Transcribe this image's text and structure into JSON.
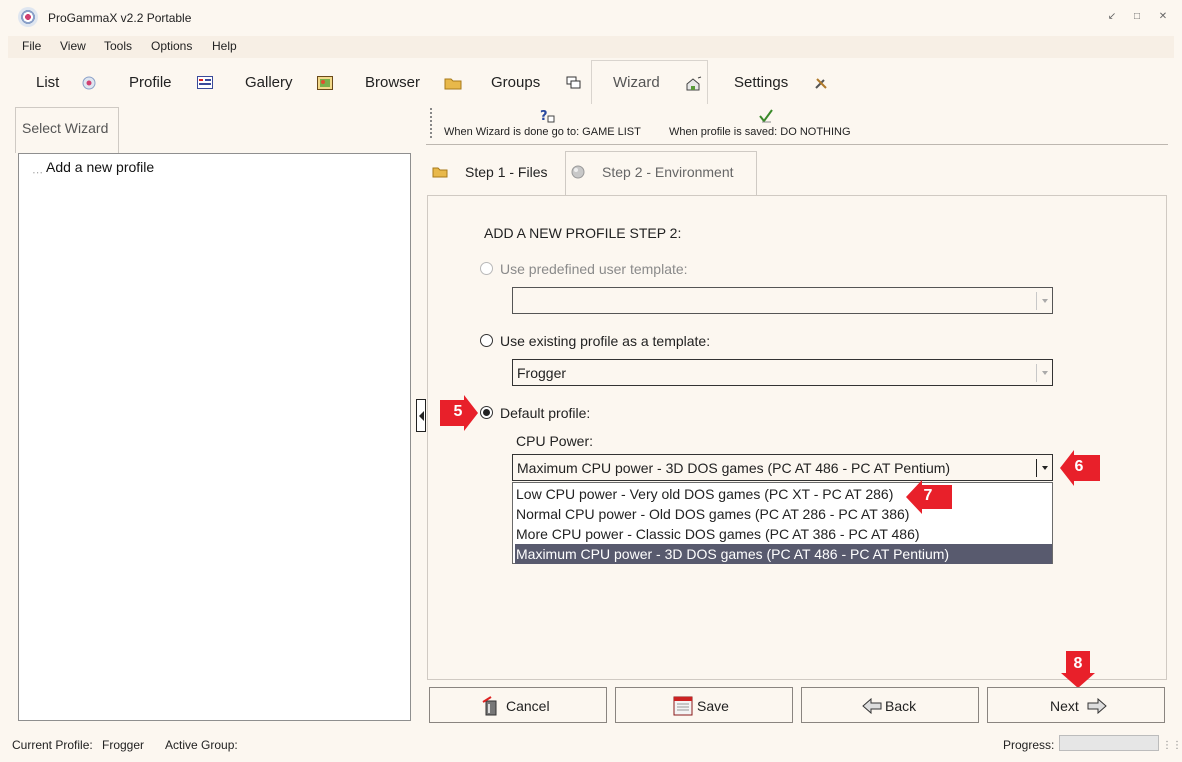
{
  "window": {
    "title": "ProGammaX v2.2 Portable"
  },
  "menu": [
    "File",
    "View",
    "Tools",
    "Options",
    "Help"
  ],
  "main_tabs": {
    "list": "List",
    "profile": "Profile",
    "gallery": "Gallery",
    "browser": "Browser",
    "groups": "Groups",
    "wizard": "Wizard",
    "settings": "Settings",
    "active": "Wizard"
  },
  "left_pane": {
    "tab_label": "Select Wizard",
    "tree_items": [
      "Add a new profile"
    ]
  },
  "toolbar": {
    "wizard_done": "When Wizard is done go to: GAME LIST",
    "profile_saved": "When profile is saved: DO NOTHING"
  },
  "step_tabs": {
    "step1": "Step 1 - Files",
    "step2": "Step 2 - Environment",
    "active": "Step 2 - Environment"
  },
  "content": {
    "heading": "ADD A NEW PROFILE STEP 2:",
    "option_predefined": "Use predefined user template:",
    "predefined_value": "",
    "option_existing": "Use existing profile as a template:",
    "existing_value": "Frogger",
    "option_default": "Default profile:",
    "selected_option": "Default profile:",
    "cpu_label": "CPU Power:",
    "cpu_value": "Maximum CPU power - 3D DOS games (PC AT 486 - PC AT Pentium)",
    "cpu_options": [
      "Low CPU power - Very old DOS games (PC XT - PC AT 286)",
      "Normal CPU power - Old DOS games (PC AT 286 - PC AT 386)",
      "More CPU power - Classic DOS games (PC AT 386 - PC AT 486)",
      "Maximum CPU power - 3D DOS games (PC AT 486 - PC AT Pentium)"
    ],
    "cpu_selected_index": 3
  },
  "annotations": [
    "5",
    "6",
    "7",
    "8"
  ],
  "buttons": {
    "cancel": "Cancel",
    "save": "Save",
    "back": "Back",
    "next": "Next"
  },
  "status": {
    "current_profile_label": "Current Profile:",
    "current_profile_value": "Frogger",
    "active_group_label": "Active Group:",
    "active_group_value": "",
    "progress_label": "Progress:",
    "progress_value": 0
  },
  "colors": {
    "background": "#fcf7f0",
    "selection": "#585a6e",
    "annotation": "#e8202a"
  }
}
